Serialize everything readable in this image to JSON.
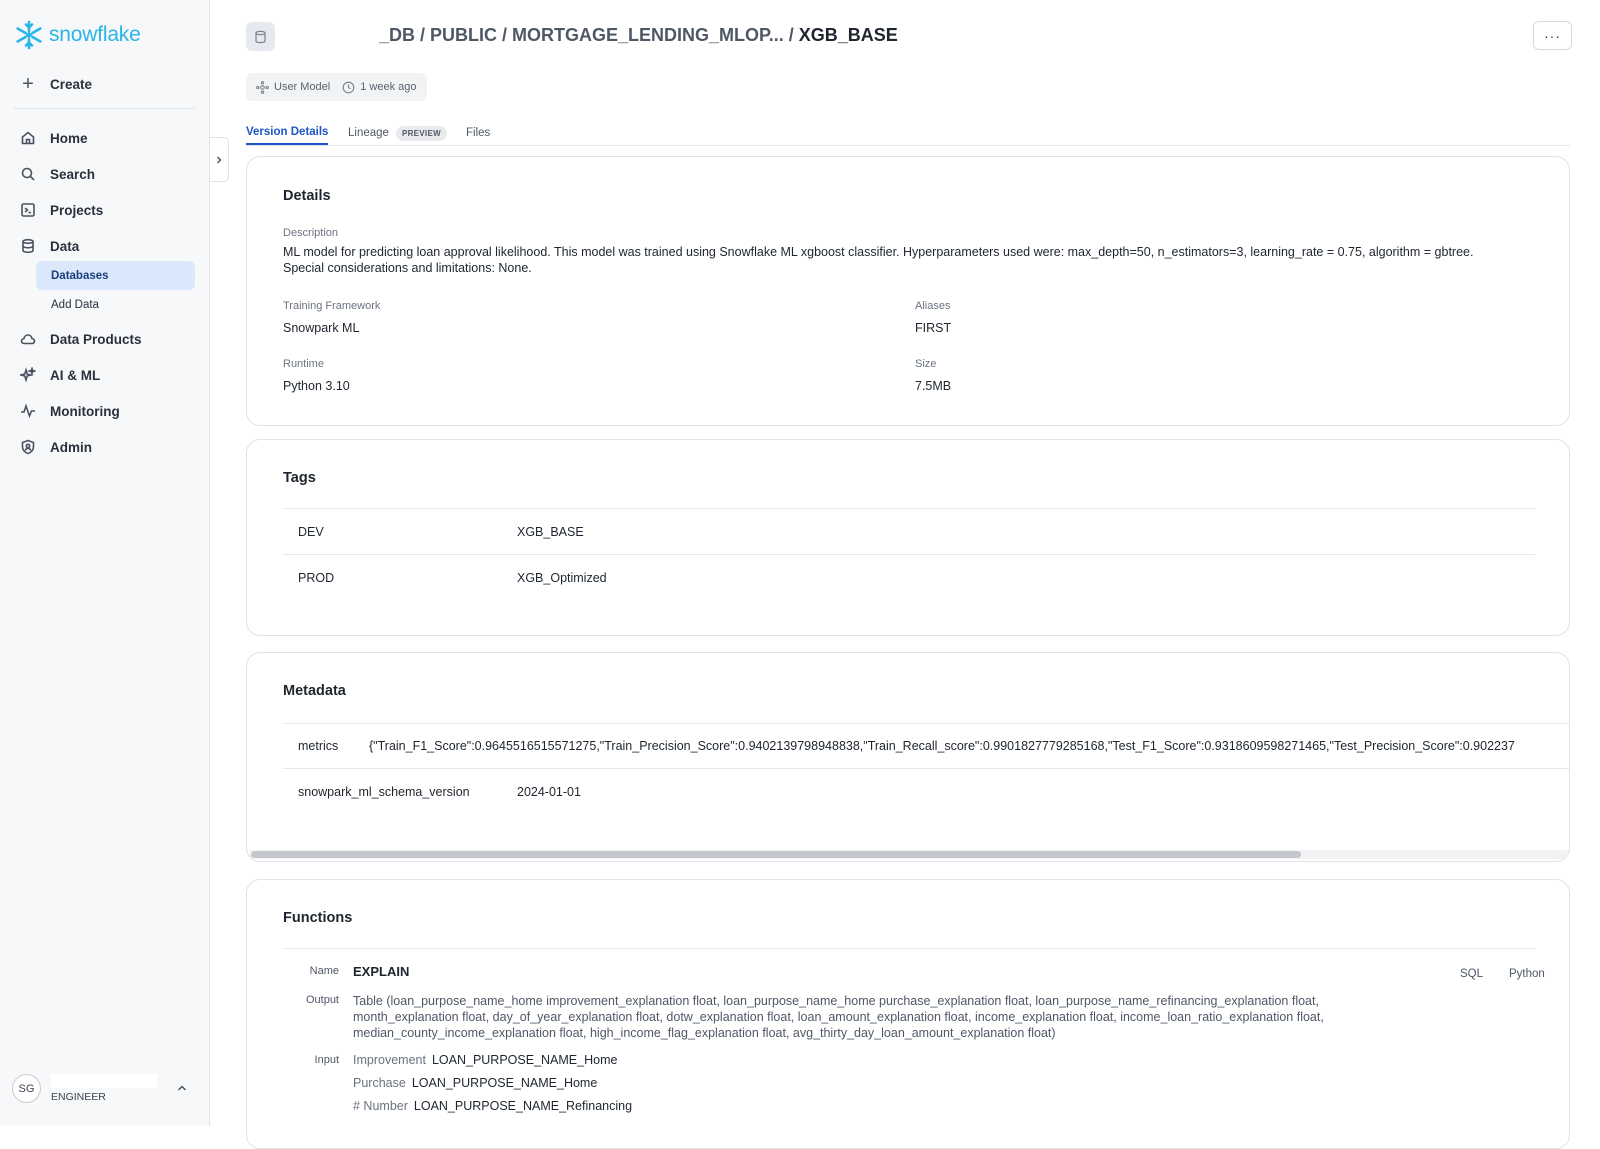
{
  "app": {
    "logo_text": "snowflake",
    "brand_color": "#29b5e8",
    "accent_color": "#1b56c4"
  },
  "sidebar": {
    "create_label": "Create",
    "items": [
      {
        "label": "Home",
        "icon": "home-icon"
      },
      {
        "label": "Search",
        "icon": "search-icon"
      },
      {
        "label": "Projects",
        "icon": "projects-icon"
      },
      {
        "label": "Data",
        "icon": "database-icon"
      },
      {
        "label": "Data Products",
        "icon": "cloud-icon"
      },
      {
        "label": "AI & ML",
        "icon": "sparkle-icon"
      },
      {
        "label": "Monitoring",
        "icon": "activity-icon"
      },
      {
        "label": "Admin",
        "icon": "shield-icon"
      }
    ],
    "data_sub": [
      {
        "label": "Databases",
        "active": true
      },
      {
        "label": "Add Data",
        "active": false
      }
    ],
    "user": {
      "initials": "SG",
      "role": "ENGINEER"
    }
  },
  "header": {
    "breadcrumb_path": "_DB / PUBLIC / MORTGAGE_LENDING_MLOP... / ",
    "breadcrumb_current": "XGB_BASE",
    "more_label": "···",
    "type_label": "User Model",
    "time_label": "1 week ago"
  },
  "tabs": [
    {
      "label": "Version Details",
      "active": true
    },
    {
      "label": "Lineage",
      "badge": "PREVIEW"
    },
    {
      "label": "Files"
    }
  ],
  "details": {
    "title": "Details",
    "description_label": "Description",
    "description": "ML model for predicting loan approval likelihood. This model was trained using Snowflake ML xgboost classifier. Hyperparameters used were: max_depth=50, n_estimators=3, learning_rate = 0.75, algorithm = gbtree. Special considerations and limitations: None.",
    "training_framework_label": "Training Framework",
    "training_framework": "Snowpark ML",
    "aliases_label": "Aliases",
    "aliases": "FIRST",
    "runtime_label": "Runtime",
    "runtime": "Python 3.10",
    "size_label": "Size",
    "size": "7.5MB"
  },
  "tags": {
    "title": "Tags",
    "rows": [
      {
        "key": "DEV",
        "value": "XGB_BASE"
      },
      {
        "key": "PROD",
        "value": "XGB_Optimized"
      }
    ]
  },
  "metadata": {
    "title": "Metadata",
    "rows": [
      {
        "key": "metrics",
        "value": "{\"Train_F1_Score\":0.9645516515571275,\"Train_Precision_Score\":0.9402139798948838,\"Train_Recall_score\":0.9901827779285168,\"Test_F1_Score\":0.9318609598271465,\"Test_Precision_Score\":0.902237"
      },
      {
        "key": "snowpark_ml_schema_version",
        "value": "2024-01-01"
      }
    ]
  },
  "functions": {
    "title": "Functions",
    "name_label": "Name",
    "name": "EXPLAIN",
    "sql_tab": "SQL",
    "python_tab": "Python",
    "output_label": "Output",
    "output": "Table (loan_purpose_name_home improvement_explanation float, loan_purpose_name_home purchase_explanation float, loan_purpose_name_refinancing_explanation float, month_explanation float, day_of_year_explanation float, dotw_explanation float, loan_amount_explanation float, income_explanation float, income_loan_ratio_explanation float, median_county_income_explanation float, high_income_flag_explanation float, avg_thirty_day_loan_amount_explanation float)",
    "input_label": "Input",
    "inputs": [
      {
        "type": "Improvement",
        "name": "LOAN_PURPOSE_NAME_Home"
      },
      {
        "type": "Purchase",
        "name": "LOAN_PURPOSE_NAME_Home"
      },
      {
        "type": "# Number",
        "name": "LOAN_PURPOSE_NAME_Refinancing"
      }
    ]
  }
}
